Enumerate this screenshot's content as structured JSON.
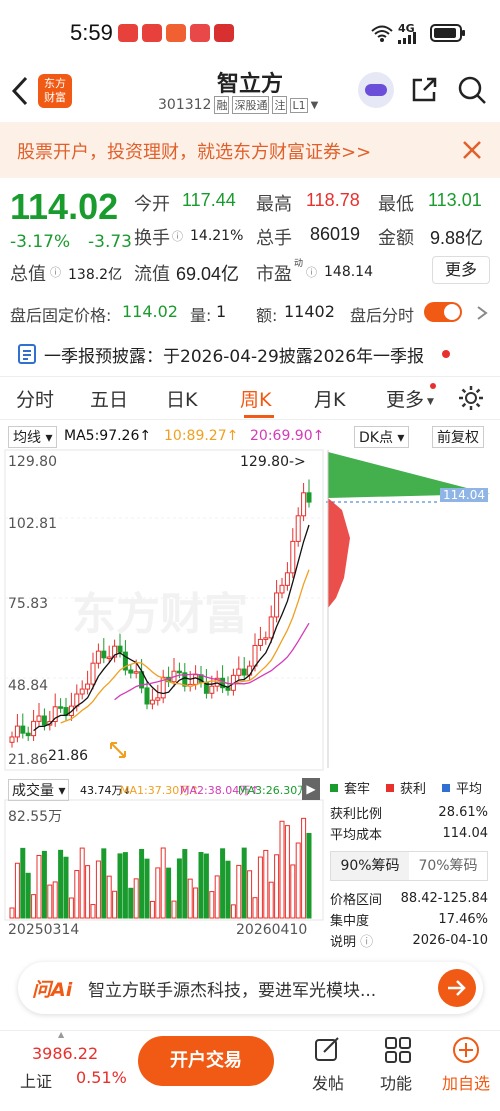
{
  "status": {
    "time": "5:59",
    "network": "4G"
  },
  "header": {
    "title": "智立方",
    "code": "301312",
    "tag_rong": "融",
    "tag_market": "深股通",
    "tag_zhu": "注",
    "tag_level": "L1",
    "brand_line1": "东方",
    "brand_line2": "财富"
  },
  "banner": {
    "text": "股票开户，投资理财，就选东方财富证券>>"
  },
  "quote": {
    "price": "114.02",
    "change_pct": "-3.17%",
    "change": "-3.73",
    "open_label": "今开",
    "open": "117.44",
    "high_label": "最高",
    "high": "118.78",
    "low_label": "最低",
    "low": "113.01",
    "turnover_label": "换手",
    "turnover": "14.21%",
    "volume_label": "总手",
    "volume": "86019",
    "amount_label": "金额",
    "amount": "9.88亿",
    "mktcap_label": "总值",
    "mktcap": "138.2亿",
    "float_label": "流值",
    "float": "69.04亿",
    "pe_label": "市盈",
    "pe_sup": "动",
    "pe": "148.14",
    "more": "更多"
  },
  "after_hours": {
    "price_label": "盘后固定价格:",
    "price": "114.02",
    "vol_label": "量:",
    "vol": "1",
    "amt_label": "额:",
    "amt": "11402",
    "toggle_label": "盘后分时"
  },
  "notice": {
    "text": "一季报预披露：于2026-04-29披露2026年一季报"
  },
  "tabs": [
    "分时",
    "五日",
    "日K",
    "周K",
    "月K",
    "更多"
  ],
  "active_tab": "周K",
  "ma": {
    "type": "均线",
    "ma5": "MA5:97.26↑",
    "ma10": "10:89.27↑",
    "ma20": "20:69.90↑",
    "dk": "DK点",
    "adjust": "前复权"
  },
  "price_axis": {
    "ticks": [
      "129.80",
      "102.81",
      "75.83",
      "48.84",
      "21.86"
    ],
    "max_label": "129.80->",
    "min_label": "21.86",
    "current": "114.04"
  },
  "watermark": "东方财富",
  "volume_panel": {
    "title": "成交量",
    "v": "43.74万↓",
    "ma1": "MA1:37.30万↑",
    "ma2": "MA2:38.04万↑",
    "ma3": "MA3:26.30万↑",
    "max": "82.55万",
    "date_start": "20250314",
    "date_end": "20260410"
  },
  "chip": {
    "legend": [
      "套牢",
      "获利",
      "平均"
    ],
    "profit_ratio_label": "获利比例",
    "profit_ratio": "28.61%",
    "avg_cost_label": "平均成本",
    "avg_cost": "114.04",
    "tab90": "90%筹码",
    "tab70": "70%筹码",
    "range_label": "价格区间",
    "range": "88.42-125.84",
    "concentration_label": "集中度",
    "concentration": "17.46%",
    "note_label": "说明",
    "note_date": "2026-04-10"
  },
  "ai": {
    "logo": "问Ai",
    "text": "智立方联手源杰科技，要进军光模块..."
  },
  "bottom": {
    "index_value": "3986.22",
    "index_name": "上证",
    "index_change": "0.51%",
    "trade_btn": "开户交易",
    "post": "发帖",
    "func": "功能",
    "add": "加自选"
  },
  "colors": {
    "up": "#e8302c",
    "down": "#1a9b2e",
    "accent": "#f05a14",
    "ma5": "#111111",
    "ma10": "#f0a020",
    "ma20": "#d43bb8"
  }
}
